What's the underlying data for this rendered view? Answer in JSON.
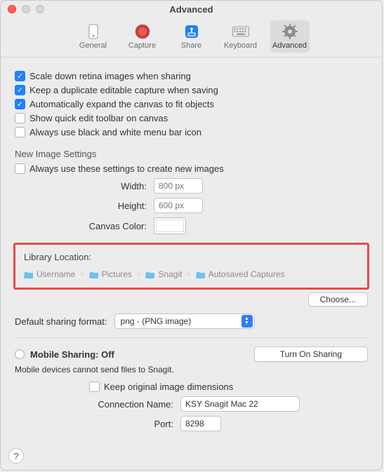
{
  "window": {
    "title": "Advanced"
  },
  "tabs": {
    "general": "General",
    "capture": "Capture",
    "share": "Share",
    "keyboard": "Keyboard",
    "advanced": "Advanced"
  },
  "checks": {
    "scale_retina": "Scale down retina images when sharing",
    "duplicate": "Keep a duplicate editable capture when saving",
    "expand_canvas": "Automatically expand the canvas to fit objects",
    "quick_edit": "Show quick edit toolbar on canvas",
    "bw_menubar": "Always use black and white menu bar icon"
  },
  "new_image": {
    "heading": "New Image Settings",
    "always": "Always use these settings to create new images",
    "width_label": "Width:",
    "width_ph": "800 px",
    "height_label": "Height:",
    "height_ph": "600 px",
    "color_label": "Canvas Color:"
  },
  "library": {
    "title": "Library Location:",
    "path": [
      "Username",
      "Pictures",
      "Snagit",
      "Autosaved Captures"
    ],
    "choose": "Choose..."
  },
  "sharing_format": {
    "label": "Default sharing format:",
    "value": "png - (PNG image)"
  },
  "mobile": {
    "title": "Mobile Sharing: Off",
    "button": "Turn On Sharing",
    "sub": "Mobile devices cannot send files to Snagit.",
    "keep_dims": "Keep original image dimensions",
    "conn_label": "Connection Name:",
    "conn_value": "KSY Snagit Mac 22",
    "port_label": "Port:",
    "port_value": "8298"
  }
}
